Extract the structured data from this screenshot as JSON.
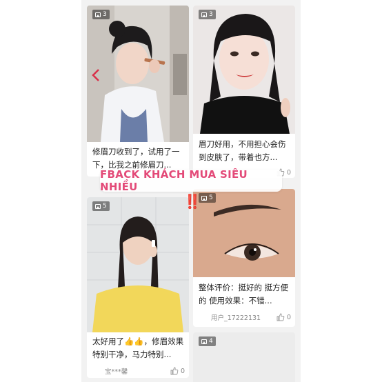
{
  "banner": {
    "text": "FBACK KHÁCH MUA SIÊU NHIỀU",
    "alert": "‼️"
  },
  "cards": [
    {
      "badge": "3",
      "caption": "修眉刀收到了，试用了一下，比我之前修眉刀...",
      "user": "",
      "likes": ""
    },
    {
      "badge": "3",
      "caption": "眉刀好用，不用担心会伤到皮肤了，带着也方...",
      "user": "",
      "likes": "0"
    },
    {
      "badge": "5",
      "caption": "太好用了👍👍，修眉效果特别干净，马力特别...",
      "user": "宝***馨",
      "likes": "0"
    },
    {
      "badge": "5",
      "caption": "整体评价：挺好的 挺方便的 使用效果：不错...",
      "user": "用户_17222131",
      "likes": "0"
    },
    {
      "badge": "4",
      "caption": "",
      "user": "",
      "likes": ""
    }
  ],
  "colors": {
    "banner_text": "#e34a78",
    "alert": "#e52222",
    "background": "#f2f2f2"
  },
  "icons": [
    "image-count-icon",
    "thumbs-up-icon",
    "chevron-left-icon"
  ]
}
